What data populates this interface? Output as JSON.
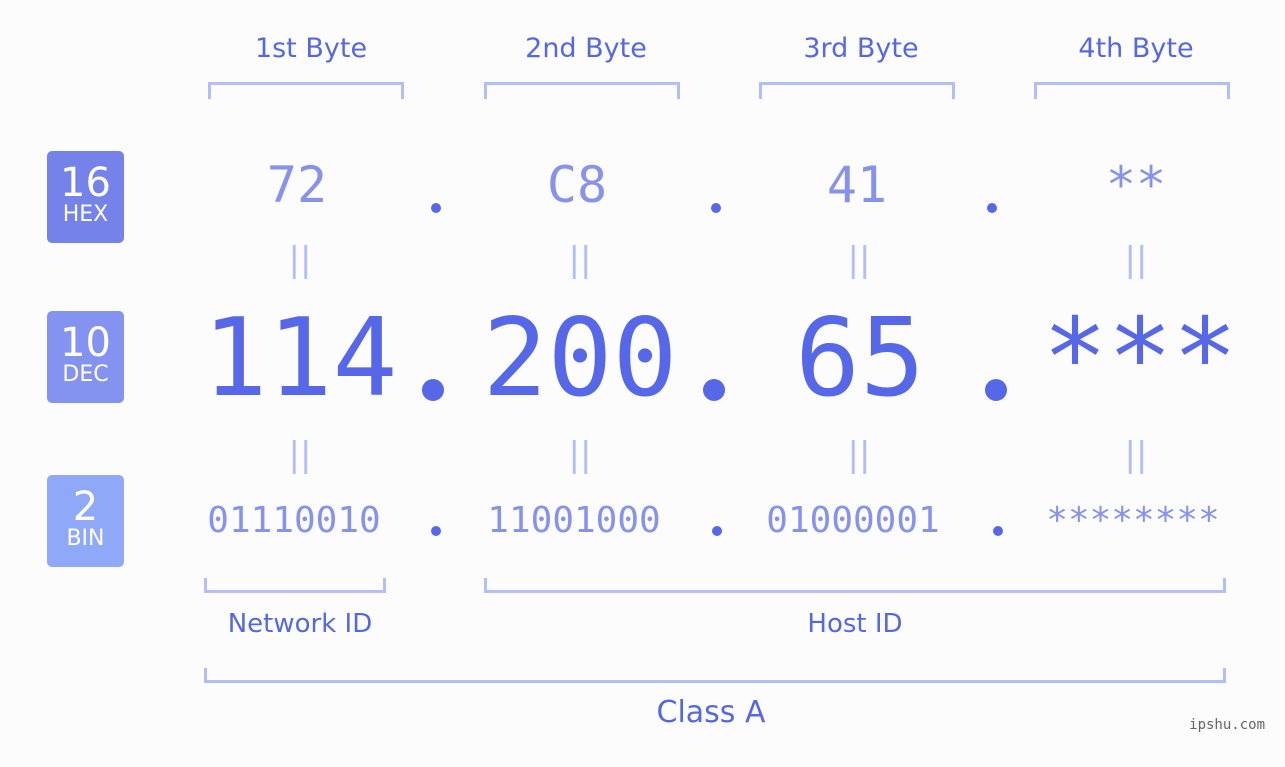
{
  "byte_headers": [
    "1st Byte",
    "2nd Byte",
    "3rd Byte",
    "4th Byte"
  ],
  "badges": [
    {
      "num": "16",
      "unit": "HEX",
      "color": "#7482ea"
    },
    {
      "num": "10",
      "unit": "DEC",
      "color": "#8593f0"
    },
    {
      "num": "2",
      "unit": "BIN",
      "color": "#90a8f8"
    }
  ],
  "hex": [
    "72",
    "C8",
    "41",
    "**"
  ],
  "dec": [
    "114",
    "200",
    "65",
    "***"
  ],
  "bin": [
    "01110010",
    "11001000",
    "01000001",
    "********"
  ],
  "equals_symbol": "||",
  "network_id_label": "Network ID",
  "host_id_label": "Host ID",
  "class_label": "Class A",
  "watermark": "ipshu.com"
}
